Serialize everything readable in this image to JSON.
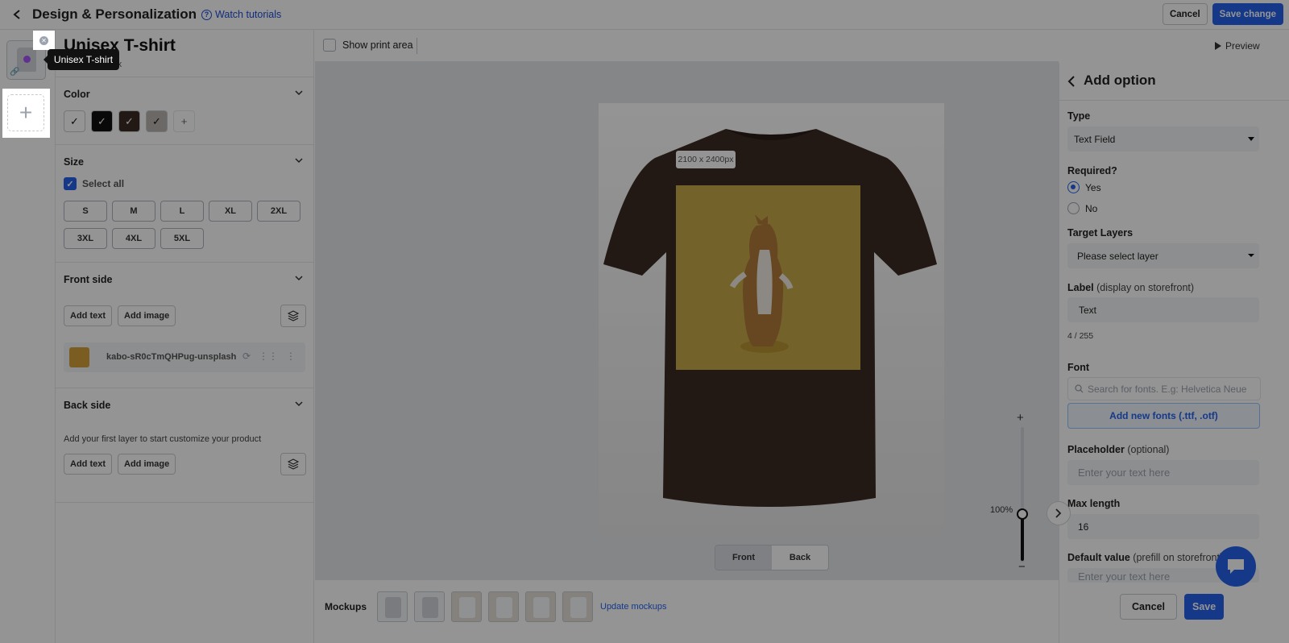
{
  "header": {
    "title": "Design & Personalization",
    "watch_tutorials": "Watch tutorials",
    "cancel": "Cancel",
    "save_change": "Save change"
  },
  "product": {
    "name": "Unisex T-shirt",
    "size_text": "2100 x 2400px",
    "tooltip": "Unisex T-shirt"
  },
  "color": {
    "title": "Color",
    "swatches": [
      "#ffffff",
      "#111111",
      "#3b2a24",
      "#b9b4b0"
    ]
  },
  "size": {
    "title": "Size",
    "select_all": "Select all",
    "options": [
      "S",
      "M",
      "L",
      "XL",
      "2XL",
      "3XL",
      "4XL",
      "5XL"
    ]
  },
  "front": {
    "title": "Front side",
    "add_text": "Add text",
    "add_image": "Add image",
    "layer_name": "kabo-sR0cTmQHPug-unsplash"
  },
  "back": {
    "title": "Back side",
    "hint": "Add your first layer to start customize your product",
    "add_text": "Add text",
    "add_image": "Add image"
  },
  "canvas": {
    "show_print_area": "Show print area",
    "preview": "Preview",
    "print_size": "2100 x 2400px",
    "front": "Front",
    "back": "Back",
    "zoom": "100%",
    "zoom_level": 1.0,
    "shirt_color": "#3b2a24"
  },
  "mockups": {
    "label": "Mockups",
    "update": "Update mockups"
  },
  "panel": {
    "title": "Add option",
    "type_label": "Type",
    "type_value": "Text Field",
    "required_label": "Required?",
    "yes": "Yes",
    "no": "No",
    "target_layers_label": "Target Layers",
    "target_layers_value": "Please select layer",
    "label_label": "Label",
    "label_hint": "(display on storefront)",
    "label_value": "Text",
    "label_count": "4 / 255",
    "font_label": "Font",
    "font_placeholder": "Search for fonts. E.g: Helvetica Neue",
    "add_fonts": "Add new fonts (.ttf, .otf)",
    "placeholder_label": "Placeholder",
    "placeholder_hint": "(optional)",
    "placeholder_value": "Enter your text here",
    "maxlength_label": "Max length",
    "maxlength_value": "16",
    "default_label": "Default value",
    "default_hint": "(prefill on storefront)",
    "default_placeholder": "Enter your text here",
    "cancel": "Cancel",
    "save": "Save"
  },
  "colors": {
    "primary": "#2563eb",
    "overlay": "rgba(0,0,0,0.42)"
  }
}
